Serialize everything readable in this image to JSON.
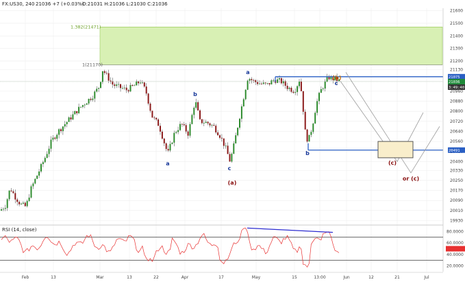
{
  "header": {
    "symbol": "FX:US30, 240",
    "change": "21036 +7 (+0.03%)",
    "ohlc": "O:21031 H:21036 L:21030 C:21036"
  },
  "rsi_header": "RSI (14, close)",
  "colors": {
    "up": "#2e8b2e",
    "down": "#8b1a1a",
    "wick": "#333333",
    "fib_zone": "#d8f0b4",
    "fib_border": "#9ccc5a",
    "level": "#2a5fc4",
    "target_box": "#f9eecb",
    "target_border": "#555555",
    "rsi_line": "#e83030",
    "rsi_trend": "#2b2bd0",
    "path": "#9a9a9a"
  },
  "chart_data": {
    "type": "candlestick",
    "price_axis": {
      "ticks": [
        "21600",
        "21500",
        "21400",
        "21300",
        "21200",
        "21130",
        "21040",
        "20960",
        "20880",
        "20800",
        "20720",
        "20640",
        "20560",
        "20480",
        "20400",
        "20330",
        "20250",
        "20170",
        "20090",
        "20010",
        "19930"
      ],
      "ylim": [
        19900,
        21600
      ]
    },
    "time_axis": {
      "labels": [
        "Feb",
        "13",
        "Mar",
        "13",
        "22",
        "Apr",
        "17",
        "May",
        "15",
        "13:00",
        "Jun",
        "12",
        "21",
        "Jul"
      ]
    },
    "candles": [],
    "fib_levels": [
      {
        "label": "1(21170)",
        "value": 21170
      },
      {
        "label": "1.382(21471)",
        "value": 21471
      }
    ],
    "levels": [
      {
        "value": 21075,
        "label": "21075"
      },
      {
        "value": 20491,
        "label": "20491"
      }
    ],
    "price_tags": [
      {
        "value": 21075,
        "label": "21075",
        "color": "#2a5fc4"
      },
      {
        "value": 21036,
        "label": "21036",
        "color": "#1f8a3a"
      },
      {
        "value": 20995,
        "label": "3:49:40",
        "color": "#333333"
      },
      {
        "value": 20491,
        "label": "20491",
        "color": "#2a5fc4"
      }
    ],
    "wave_labels": [
      {
        "text": "a",
        "color": "blue"
      },
      {
        "text": "b",
        "color": "blue"
      },
      {
        "text": "c",
        "color": "blue"
      },
      {
        "text": "(a)",
        "color": "red"
      },
      {
        "text": "a",
        "color": "blue"
      },
      {
        "text": "b",
        "color": "blue"
      },
      {
        "text": "c",
        "color": "blue"
      },
      {
        "text": "(b)",
        "color": "orange"
      },
      {
        "text": "(c)",
        "color": "red"
      },
      {
        "text": "or (c)",
        "color": "red"
      }
    ],
    "rsi": {
      "ticks": [
        "80.0000",
        "60.0000",
        "40.0000",
        "20.0000"
      ],
      "ylim": [
        10,
        90
      ],
      "bands": [
        70,
        30
      ],
      "values": []
    }
  }
}
